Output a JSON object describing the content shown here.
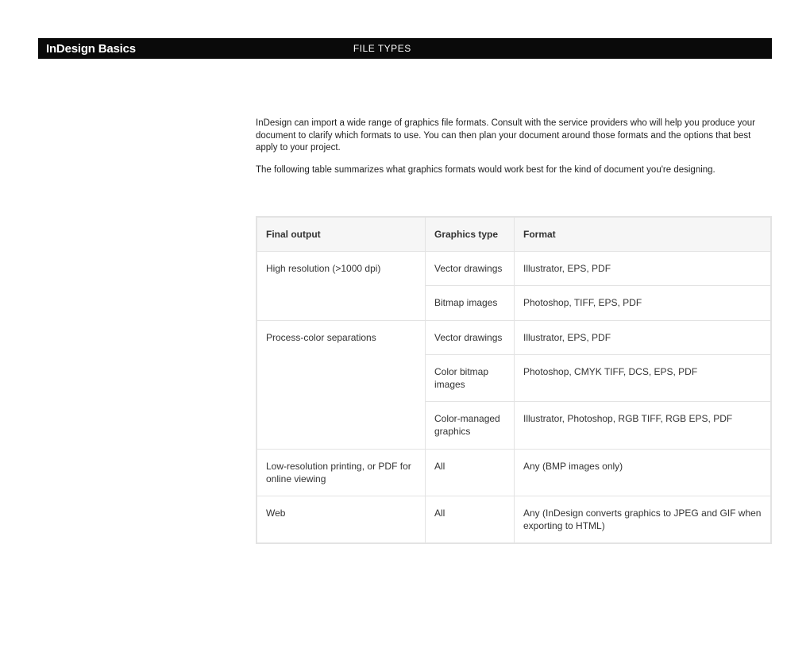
{
  "header": {
    "title": "InDesign Basics",
    "section": "FILE TYPES"
  },
  "intro": {
    "p1": "InDesign can import a wide range of graphics file formats. Consult with the service providers who will help you produce your document to clarify which formats to use. You can then plan your document around those formats and the options that best apply to your project.",
    "p2": "The following table summarizes what graphics formats would work best for the kind of document you're designing."
  },
  "table": {
    "headers": {
      "c1": "Final output",
      "c2": "Graphics type",
      "c3": "Format"
    },
    "r1": {
      "c1": "High resolution (>1000 dpi)",
      "c2": "Vector drawings",
      "c3": "Illustrator, EPS, PDF"
    },
    "r2": {
      "c2": "Bitmap images",
      "c3": "Photoshop, TIFF, EPS, PDF"
    },
    "r3": {
      "c1": "Process-color separations",
      "c2": "Vector drawings",
      "c3": "Illustrator, EPS, PDF"
    },
    "r4": {
      "c2": "Color bitmap images",
      "c3": "Photoshop, CMYK TIFF, DCS, EPS, PDF"
    },
    "r5": {
      "c2": "Color-managed graphics",
      "c3": "Illustrator, Photoshop, RGB TIFF, RGB EPS, PDF"
    },
    "r6": {
      "c1": "Low-resolution printing, or PDF for online viewing",
      "c2": "All",
      "c3": "Any (BMP images only)"
    },
    "r7": {
      "c1": "Web",
      "c2": "All",
      "c3": "Any (InDesign converts graphics to JPEG and GIF when exporting to HTML)"
    }
  }
}
